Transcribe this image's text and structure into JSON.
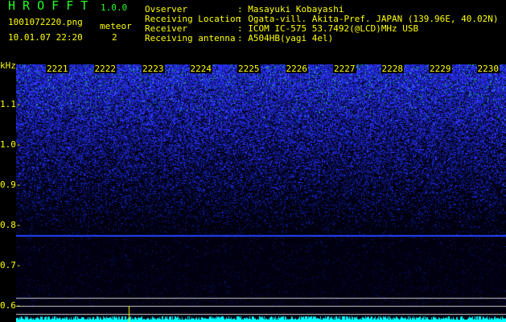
{
  "app": {
    "name": "H R O F F T",
    "version": "1.0.0"
  },
  "file": {
    "name": "1001072220.png",
    "datetime": "10.01.07 22:20"
  },
  "meteor": {
    "label": "meteor",
    "count": "2"
  },
  "info": [
    {
      "label": "Ovserver",
      "value": "Masayuki Kobayashi"
    },
    {
      "label": "Receiving Location",
      "value": "Ogata-vill. Akita-Pref. JAPAN (139.96E, 40.02N)"
    },
    {
      "label": "Receiver",
      "value": "ICOM IC-575 53.7492(@LCD)MHz USB"
    },
    {
      "label": "Receiving antenna",
      "value": "A504HB(yagi 4el)"
    }
  ],
  "axis": {
    "unit": "kHz",
    "y_labels": [
      "1.1",
      "1.0",
      "0.9",
      "0.8",
      "0.7",
      "0.6"
    ],
    "time_labels": [
      "2221",
      "2222",
      "2223",
      "2224",
      "2225",
      "2226",
      "2227",
      "2228",
      "2229",
      "2230"
    ]
  },
  "colors": {
    "text": "#ffff00",
    "title": "#22ff22",
    "signal": "#00ffff"
  }
}
